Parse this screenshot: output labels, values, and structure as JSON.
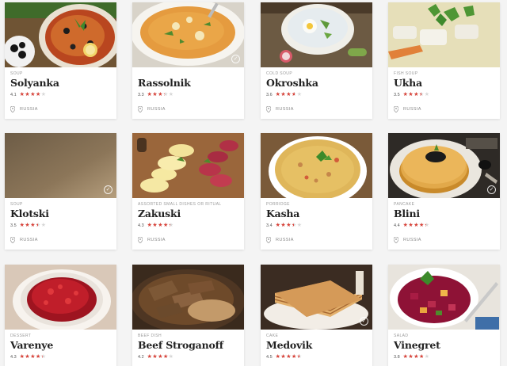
{
  "colors": {
    "accent": "#d9433a",
    "page_bg": "#f4f4f4",
    "card_bg": "#ffffff"
  },
  "pin_icon": "location-pin-icon",
  "dishes": [
    {
      "category": "Soup",
      "name": "Solyanka",
      "rating": "4.1",
      "score": 4.1,
      "country": "Russia",
      "image": "solyanka",
      "check": false
    },
    {
      "category": "",
      "name": "Rassolnik",
      "rating": "3.3",
      "score": 3.3,
      "country": "Russia",
      "image": "rassolnik",
      "check": true
    },
    {
      "category": "Cold soup",
      "name": "Okroshka",
      "rating": "3.6",
      "score": 3.6,
      "country": "Russia",
      "image": "okroshka",
      "check": false
    },
    {
      "category": "Fish soup",
      "name": "Ukha",
      "rating": "3.5",
      "score": 3.5,
      "country": "Russia",
      "image": "ukha",
      "check": false
    },
    {
      "category": "Soup",
      "name": "Klotski",
      "rating": "3.5",
      "score": 3.5,
      "country": "Russia",
      "image": "klotski",
      "check": true
    },
    {
      "category": "Assorted small dishes or ritual",
      "name": "Zakuski",
      "rating": "4.3",
      "score": 4.3,
      "country": "Russia",
      "image": "zakuski",
      "check": false
    },
    {
      "category": "Porridge",
      "name": "Kasha",
      "rating": "3.4",
      "score": 3.4,
      "country": "Russia",
      "image": "kasha",
      "check": false
    },
    {
      "category": "Pancake",
      "name": "Blini",
      "rating": "4.4",
      "score": 4.4,
      "country": "Russia",
      "image": "blini",
      "check": true
    },
    {
      "category": "Dessert",
      "name": "Varenye",
      "rating": "4.3",
      "score": 4.3,
      "country": "Russia",
      "image": "varenye",
      "check": false
    },
    {
      "category": "Beef dish",
      "name": "Beef Stroganoff",
      "rating": "4.2",
      "score": 4.2,
      "country": "Russia",
      "image": "stroganoff",
      "check": false
    },
    {
      "category": "Cake",
      "name": "Medovik",
      "rating": "4.5",
      "score": 4.5,
      "country": "Russia",
      "image": "medovik",
      "check": true
    },
    {
      "category": "Salad",
      "name": "Vinegret",
      "rating": "3.8",
      "score": 3.8,
      "country": "Russia",
      "image": "vinegret",
      "check": false
    }
  ]
}
